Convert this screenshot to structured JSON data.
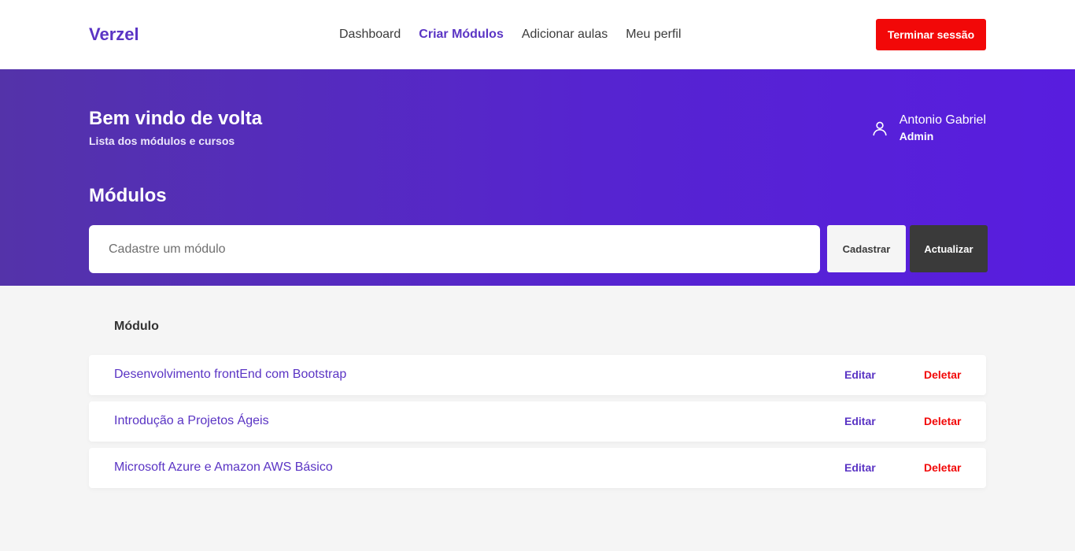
{
  "header": {
    "brand": "Verzel",
    "nav": [
      "Dashboard",
      "Criar Módulos",
      "Adicionar aulas",
      "Meu perfil"
    ],
    "logout_label": "Terminar sessão"
  },
  "hero": {
    "welcome": "Bem vindo de volta",
    "subtitle": "Lista dos módulos e cursos",
    "user_name": "Antonio Gabriel",
    "user_role": "Admin",
    "section_title": "Módulos",
    "input_placeholder": "Cadastre um módulo",
    "register_label": "Cadastrar",
    "update_label": "Actualizar"
  },
  "table": {
    "column_header": "Módulo",
    "rows": [
      {
        "name": "Desenvolvimento frontEnd com Bootstrap",
        "edit": "Editar",
        "delete": "Deletar"
      },
      {
        "name": "Introdução a Projetos Ágeis",
        "edit": "Editar",
        "delete": "Deletar"
      },
      {
        "name": "Microsoft Azure e Amazon AWS Básico",
        "edit": "Editar",
        "delete": "Deletar"
      }
    ]
  },
  "colors": {
    "accent": "#5a34c4",
    "danger": "#f20808",
    "hero_start": "#5433a9",
    "hero_end": "#581ddf"
  },
  "icons": {
    "user": "user-icon"
  }
}
